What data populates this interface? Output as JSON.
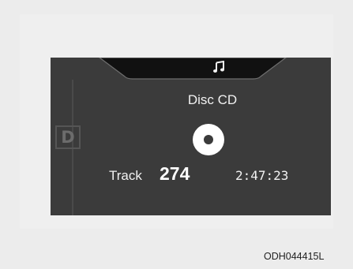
{
  "display": {
    "source_title": "Disc CD",
    "gear_indicator": "D",
    "track_label": "Track",
    "track_number": "274",
    "elapsed_time": "2:47:23",
    "top_icon": "music-note-icon",
    "center_icon": "disc-icon"
  },
  "figure_code": "ODH044415L",
  "colors": {
    "screen_background": "#3b3b3b",
    "top_tab": "#111111",
    "text": "#f2f2f2",
    "page_background": "#ececec"
  }
}
